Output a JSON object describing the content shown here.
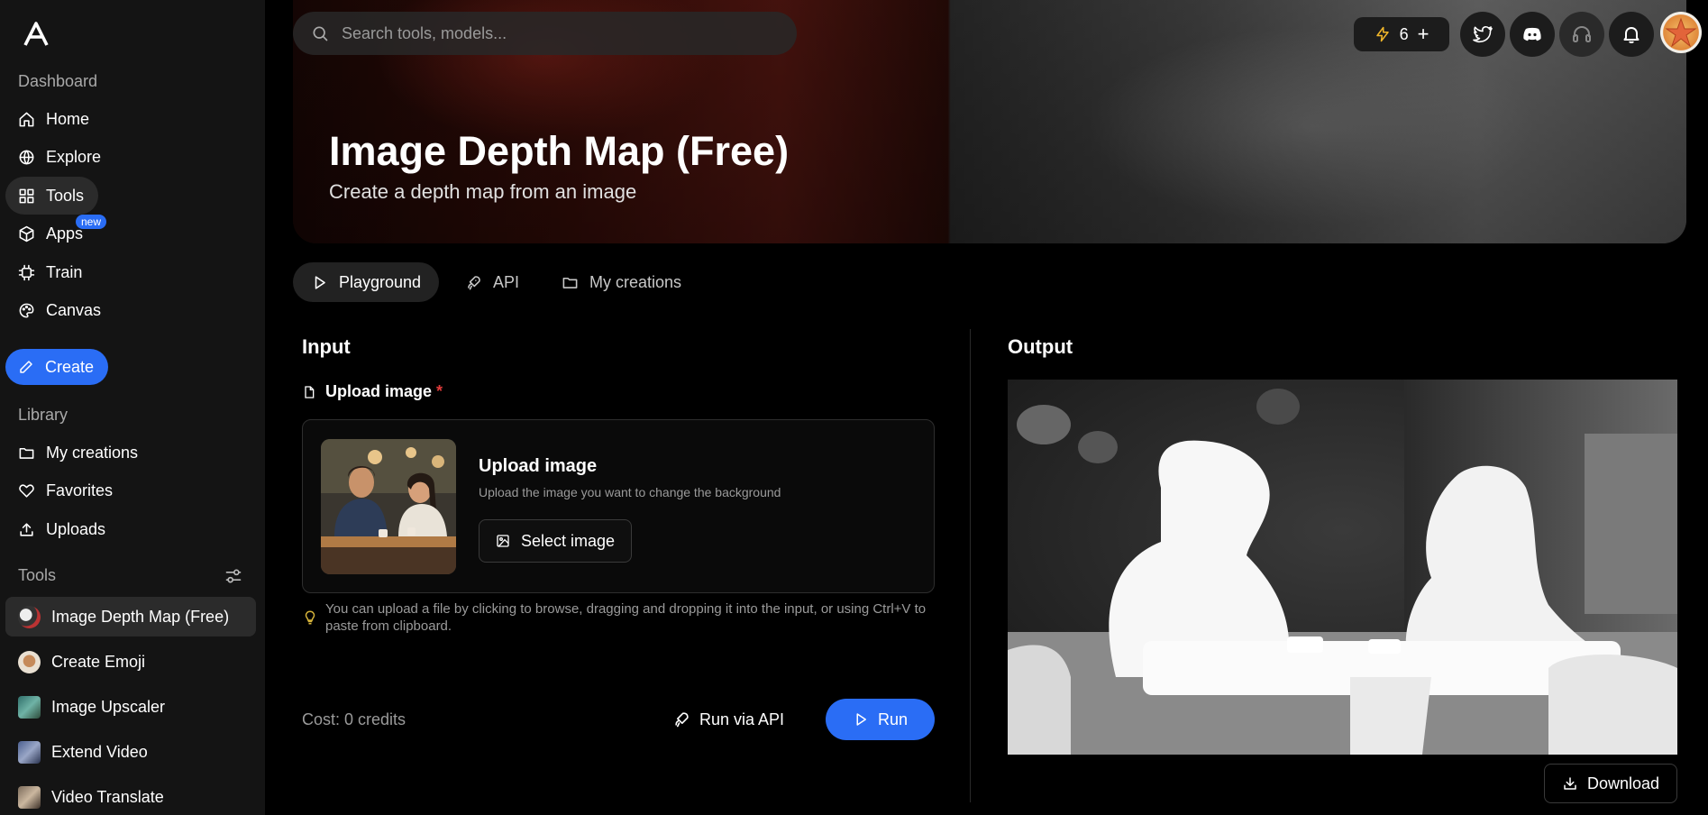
{
  "sidebar": {
    "logo": "a-logo-icon",
    "sections": {
      "dashboard": "Dashboard",
      "library": "Library",
      "tools": "Tools"
    },
    "nav": [
      {
        "label": "Home",
        "icon": "home-icon"
      },
      {
        "label": "Explore",
        "icon": "globe-icon"
      },
      {
        "label": "Tools",
        "icon": "grid-icon",
        "active": true
      },
      {
        "label": "Apps",
        "icon": "cube-icon",
        "badge": "new"
      },
      {
        "label": "Train",
        "icon": "chip-icon"
      },
      {
        "label": "Canvas",
        "icon": "palette-icon"
      }
    ],
    "create_label": "Create",
    "library": [
      {
        "label": "My creations",
        "icon": "folder-icon"
      },
      {
        "label": "Favorites",
        "icon": "heart-icon"
      },
      {
        "label": "Uploads",
        "icon": "upload-icon"
      }
    ],
    "tools": [
      {
        "label": "Image Depth Map (Free)",
        "active": true
      },
      {
        "label": "Create Emoji"
      },
      {
        "label": "Image Upscaler"
      },
      {
        "label": "Extend Video"
      },
      {
        "label": "Video Translate"
      }
    ]
  },
  "header": {
    "search_placeholder": "Search tools, models...",
    "credits_count": "6",
    "credits_add": "+"
  },
  "hero": {
    "title": "Image Depth Map (Free)",
    "subtitle": "Create a depth map from an image"
  },
  "tabs": [
    {
      "label": "Playground",
      "active": true
    },
    {
      "label": "API"
    },
    {
      "label": "My creations"
    }
  ],
  "input": {
    "title": "Input",
    "field_label": "Upload image",
    "required_mark": "*",
    "upload_title": "Upload image",
    "upload_desc": "Upload the image you want to change the background",
    "select_label": "Select image",
    "hint": "You can upload a file by clicking to browse, dragging and dropping it into the input, or using Ctrl+V to paste from clipboard.",
    "cost": "Cost: 0 credits",
    "run_api_label": "Run via API",
    "run_label": "Run"
  },
  "output": {
    "title": "Output",
    "download_label": "Download"
  },
  "colors": {
    "accent": "#2a6df5",
    "sidebar_bg": "#141414",
    "required": "#e03b3b"
  }
}
